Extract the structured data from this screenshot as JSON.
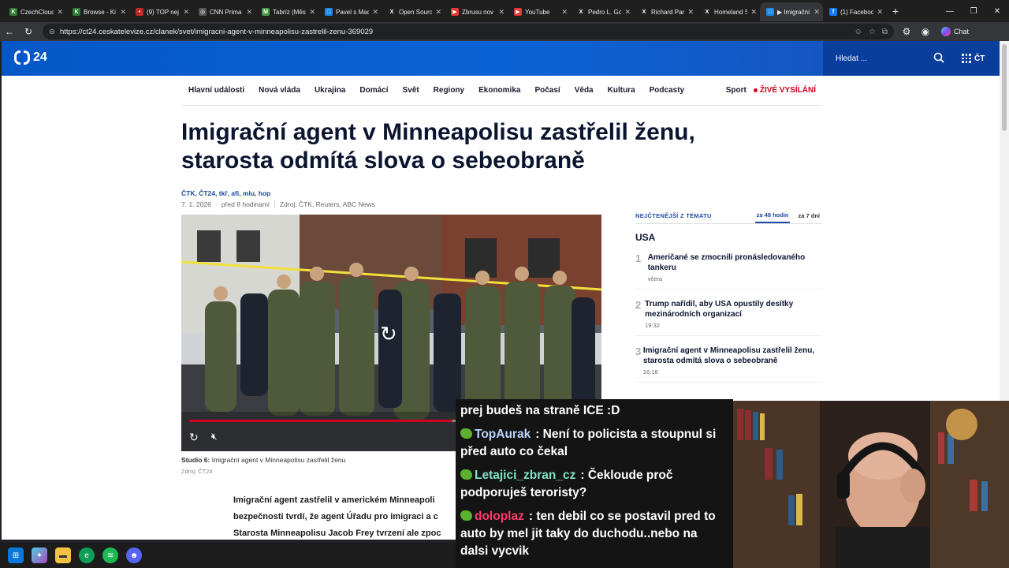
{
  "browser": {
    "tabs": [
      {
        "title": "CzechCloud",
        "color": "#2e7d32",
        "glyph": "K",
        "active": false
      },
      {
        "title": "Browse - Ki",
        "color": "#2e7d32",
        "glyph": "K",
        "active": false
      },
      {
        "title": "(9) TOP nej",
        "color": "#c62828",
        "glyph": "•",
        "active": false
      },
      {
        "title": "CNN Prima",
        "color": "#555555",
        "glyph": "◎",
        "active": false
      },
      {
        "title": "Tabríz (Měs",
        "color": "#43a047",
        "glyph": "M",
        "active": false
      },
      {
        "title": "Pavel s Mac",
        "color": "#1e88e5",
        "glyph": "□",
        "active": false
      },
      {
        "title": "Open Sourc",
        "color": "#222222",
        "glyph": "X",
        "active": false
      },
      {
        "title": "Zbrusu nov",
        "color": "#e53935",
        "glyph": "▶",
        "active": false
      },
      {
        "title": "YouTube",
        "color": "#e53935",
        "glyph": "▶",
        "active": false
      },
      {
        "title": "Pedro L. Go",
        "color": "#222222",
        "glyph": "X",
        "active": false
      },
      {
        "title": "Richard Pari",
        "color": "#222222",
        "glyph": "X",
        "active": false
      },
      {
        "title": "Homeland S",
        "color": "#222222",
        "glyph": "X",
        "active": false
      },
      {
        "title": "▶ Imigrační",
        "color": "#1e88e5",
        "glyph": "□",
        "active": true
      },
      {
        "title": "(1) Faceboo",
        "color": "#1877f2",
        "glyph": "f",
        "active": false
      }
    ],
    "url": "https://ct24.ceskatelevize.cz/clanek/svet/imigracni-agent-v-minneapolisu-zastrelil-zenu-369029",
    "chat_button": "Chat"
  },
  "site": {
    "logo_text": "24",
    "search_placeholder": "Hledat ...",
    "menu_label": "ČT",
    "nav": [
      "Hlavní události",
      "Nová vláda",
      "Ukrajina",
      "Domácí",
      "Svět",
      "Regiony",
      "Ekonomika",
      "Počasí",
      "Věda",
      "Kultura",
      "Podcasty"
    ],
    "sport": "Sport",
    "live": "ŽIVÉ VYSÍLÁNÍ"
  },
  "article": {
    "headline": "Imigrační agent v Minneapolisu zastřelil ženu, starosta odmítá slova o sebeobraně",
    "authors": "ČTK, ČT24, tkř, afi, mlu, hop",
    "date": "7. 1. 2026",
    "ago": "před 8 hodinami",
    "source": "Zdroj: ČTK, Reuters, ABC News",
    "caption_prefix": "Studio 6:",
    "caption": "Imigrační agent v Minneapolisu zastřelil ženu",
    "caption_source": "Zdroj: ČT24",
    "video_progress": 0.65,
    "body": [
      "Imigrační agent zastřelil v americkém Minneapoli",
      "bezpečnosti tvrdí, že agent Úřadu pro imigraci a c",
      "Starosta Minneapolisu Jacob Frey tvrzení ale zpoc"
    ]
  },
  "sidebar": {
    "label": "NEJČTENĚJŠÍ Z TÉMATU",
    "tab_48": "za 48 hodin",
    "tab_7": "za 7 dní",
    "topic": "USA",
    "items": [
      {
        "num": "1",
        "title": "Američané se zmocnili pronásledovaného tankeru",
        "time": "včera"
      },
      {
        "num": "2",
        "title": "Trump nařídil, aby USA opustily desítky mezinárodních organizací",
        "time": "19:32"
      },
      {
        "num": "3",
        "title": "Imigrační agent v Minneapolisu zastřelil ženu, starosta odmítá slova o sebeobraně",
        "time": "16:18"
      }
    ]
  },
  "chat": {
    "messages": [
      {
        "user": "",
        "user_color": "#ffffff",
        "text": "prej budeš na straně ICE :D"
      },
      {
        "user": "TopAurak",
        "user_color": "#b9d3ff",
        "text": "Není to policista a stoupnul si před auto co čekal"
      },
      {
        "user": "Letajici_zbran_cz",
        "user_color": "#7fe3c6",
        "text": "Čekloude proč podporuješ teroristy?"
      },
      {
        "user": "doloplaz",
        "user_color": "#ff3b6b",
        "text": "ten debil co se postavil pred to auto by mel jit taky do duchodu..nebo na dalsi vycvik"
      }
    ]
  },
  "taskbar": {
    "icons": [
      "windows-start-icon",
      "copilot-icon",
      "file-explorer-icon",
      "edge-icon",
      "spotify-icon",
      "discord-icon"
    ]
  }
}
